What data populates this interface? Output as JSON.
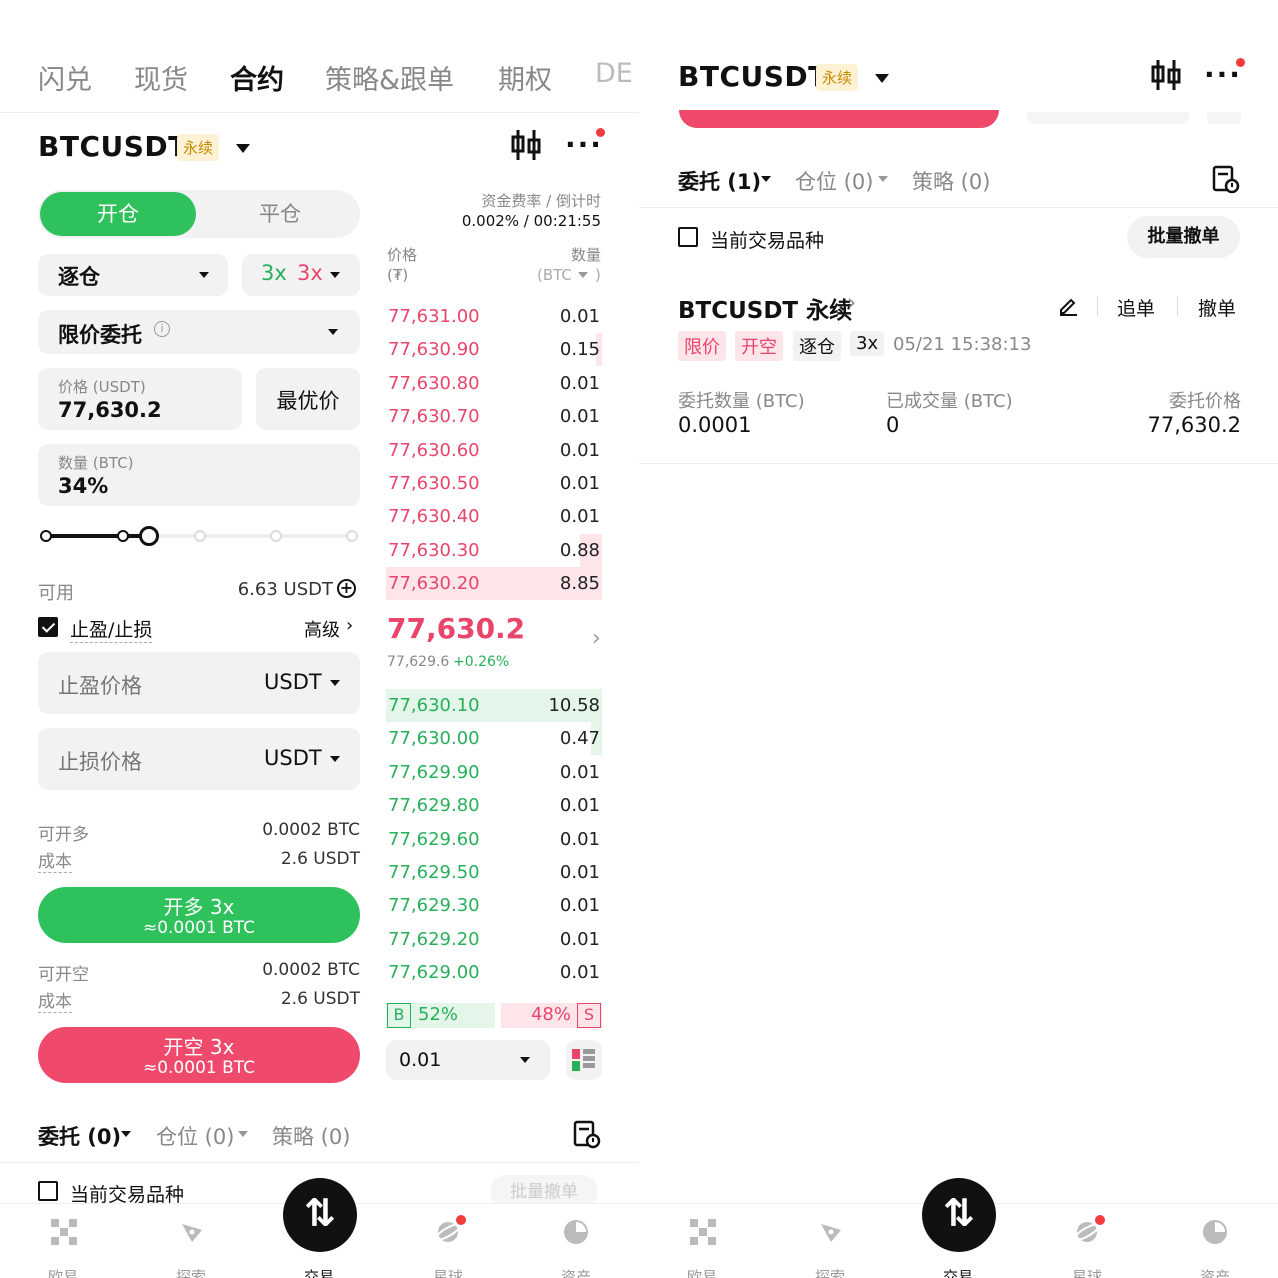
{
  "left": {
    "top_tabs": [
      "闪兑",
      "现货",
      "合约",
      "策略&跟单",
      "期权",
      "DE"
    ],
    "active_tab_index": 2,
    "symbol": "BTCUSDT",
    "perp_badge": "永续",
    "order_side_tabs": {
      "open": "开仓",
      "close": "平仓"
    },
    "funding": {
      "label": "资金费率 / 倒计时",
      "value": "0.002% / 00:21:55"
    },
    "margin_mode": "逐仓",
    "leverage": {
      "long": "3x",
      "short": "3x"
    },
    "order_type": "限价委托",
    "price_field": {
      "label": "价格 (USDT)",
      "value": "77,630.2"
    },
    "best_price_button": "最优价",
    "qty_field": {
      "label": "数量 (BTC)",
      "value": "34%"
    },
    "slider_percent": 34,
    "available": {
      "label": "可用",
      "value": "6.63 USDT"
    },
    "tpsl": {
      "label": "止盈/止损",
      "checked": true,
      "advanced": "高级"
    },
    "tp_field": {
      "placeholder": "止盈价格",
      "unit": "USDT"
    },
    "sl_field": {
      "placeholder": "止损价格",
      "unit": "USDT"
    },
    "long_info": {
      "max_label": "可开多",
      "max_value": "0.0002 BTC",
      "cost_label": "成本",
      "cost_value": "2.6 USDT"
    },
    "long_button": {
      "title": "开多 3x",
      "sub": "≈0.0001 BTC"
    },
    "short_info": {
      "max_label": "可开空",
      "max_value": "0.0002 BTC",
      "cost_label": "成本",
      "cost_value": "2.6 USDT"
    },
    "short_button": {
      "title": "开空 3x",
      "sub": "≈0.0001 BTC"
    },
    "orderbook": {
      "price_header": "价格",
      "price_unit": "(₮)",
      "qty_header": "数量",
      "qty_unit": "(BTC",
      "qty_unit_end": ")",
      "asks": [
        {
          "p": "77,631.00",
          "q": "0.01",
          "depth": 0.0
        },
        {
          "p": "77,630.90",
          "q": "0.15",
          "depth": 0.03
        },
        {
          "p": "77,630.80",
          "q": "0.01",
          "depth": 0.0
        },
        {
          "p": "77,630.70",
          "q": "0.01",
          "depth": 0.0
        },
        {
          "p": "77,630.60",
          "q": "0.01",
          "depth": 0.0
        },
        {
          "p": "77,630.50",
          "q": "0.01",
          "depth": 0.0
        },
        {
          "p": "77,630.40",
          "q": "0.01",
          "depth": 0.0
        },
        {
          "p": "77,630.30",
          "q": "0.88",
          "depth": 0.1
        },
        {
          "p": "77,630.20",
          "q": "8.85",
          "depth": 1.0
        }
      ],
      "last_price": "77,630.2",
      "mark_price": "77,629.6",
      "change": "+0.26%",
      "bids": [
        {
          "p": "77,630.10",
          "q": "10.58",
          "depth": 1.0
        },
        {
          "p": "77,630.00",
          "q": "0.47",
          "depth": 0.05
        },
        {
          "p": "77,629.90",
          "q": "0.01",
          "depth": 0.0
        },
        {
          "p": "77,629.80",
          "q": "0.01",
          "depth": 0.0
        },
        {
          "p": "77,629.60",
          "q": "0.01",
          "depth": 0.0
        },
        {
          "p": "77,629.50",
          "q": "0.01",
          "depth": 0.0
        },
        {
          "p": "77,629.30",
          "q": "0.01",
          "depth": 0.0
        },
        {
          "p": "77,629.20",
          "q": "0.01",
          "depth": 0.0
        },
        {
          "p": "77,629.00",
          "q": "0.01",
          "depth": 0.0
        }
      ],
      "ratio": {
        "buy_tag": "B",
        "buy": "52%",
        "sell": "48%",
        "sell_tag": "S",
        "buy_fraction": 0.52
      },
      "tick_size": "0.01"
    },
    "bottom_tabs": {
      "orders": "委托 (0)",
      "positions": "仓位 (0)",
      "strategies": "策略 (0)"
    },
    "current_symbol_only": "当前交易品种",
    "batch_cancel": "批量撤单"
  },
  "right": {
    "symbol": "BTCUSDT",
    "perp_badge": "永续",
    "tabs": {
      "orders": "委托 (1)",
      "positions": "仓位 (0)",
      "strategies": "策略 (0)"
    },
    "current_symbol_only": "当前交易品种",
    "batch_cancel": "批量撤单",
    "order": {
      "title": "BTCUSDT 永续",
      "chase": "追单",
      "cancel": "撤单",
      "tags": [
        "限价",
        "开空",
        "逐仓",
        "3x"
      ],
      "time": "05/21 15:38:13",
      "qty_label": "委托数量 (BTC)",
      "qty_value": "0.0001",
      "filled_label": "已成交量 (BTC)",
      "filled_value": "0",
      "price_label": "委托价格",
      "price_value": "77,630.2"
    }
  },
  "tabbar": [
    "欧易",
    "探索",
    "交易",
    "星球",
    "资产"
  ],
  "colors": {
    "green": "#2fc15c",
    "red": "#ef4a6c",
    "ask_text": "#e9456a",
    "bid_text": "#27b05a",
    "badge": "#fdf2d3"
  }
}
